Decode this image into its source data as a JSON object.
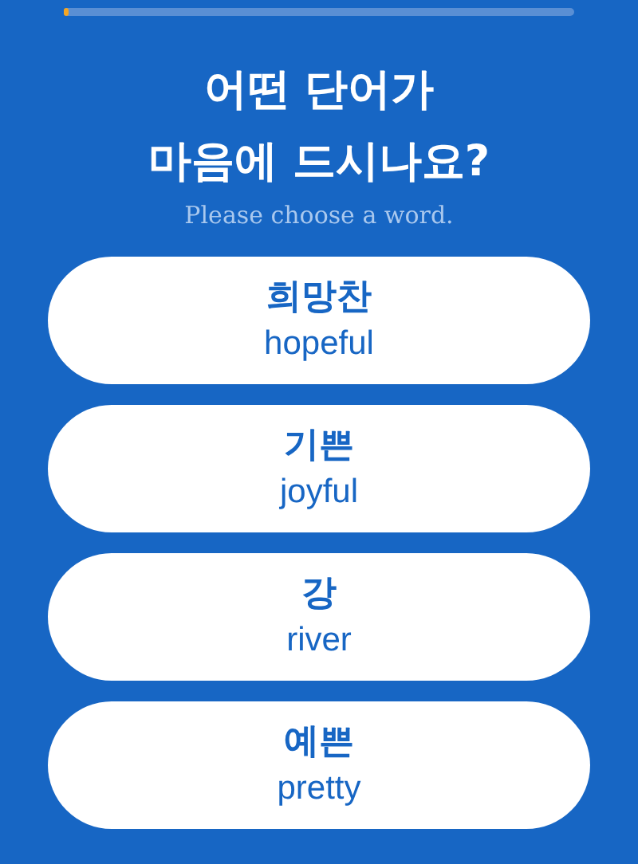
{
  "progress": {
    "level": 0.01
  },
  "title": [
    "어떤 단어가",
    "마음에 드시나요?"
  ],
  "subtitle": "Please choose a word.",
  "options": [
    {
      "korean": "희망찬",
      "english": "hopeful"
    },
    {
      "korean": "기쁜",
      "english": "joyful"
    },
    {
      "korean": "강",
      "english": "river"
    },
    {
      "korean": "예쁜",
      "english": "pretty"
    }
  ]
}
